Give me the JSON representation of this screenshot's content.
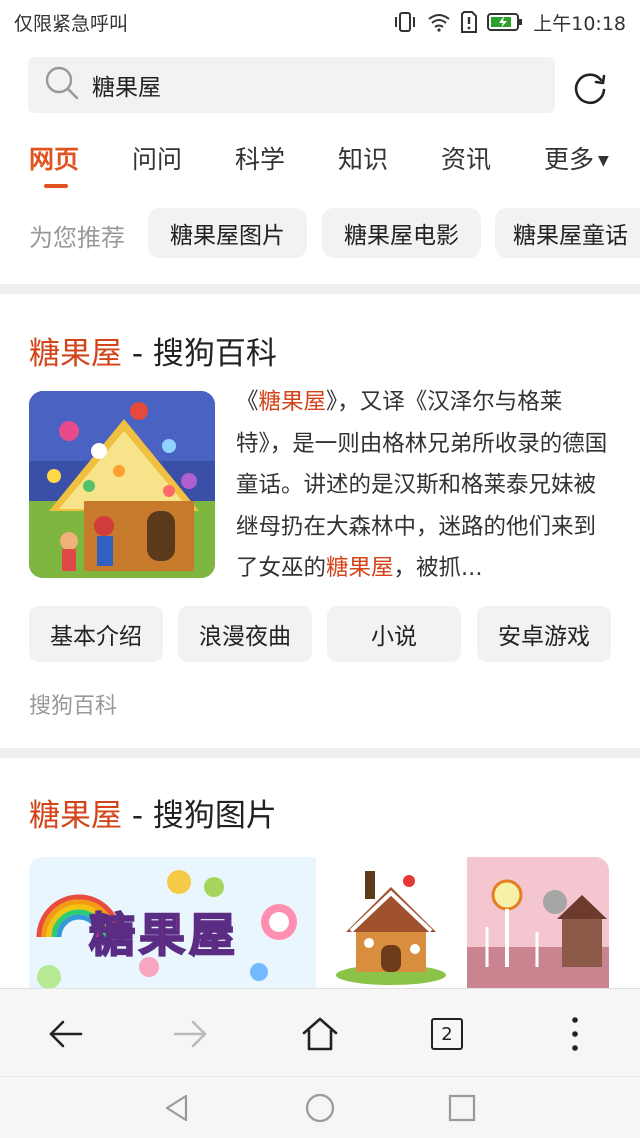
{
  "status_bar": {
    "emergency_text": "仅限紧急呼叫",
    "time": "上午10:18"
  },
  "search": {
    "query": "糖果屋"
  },
  "tabs": [
    {
      "label": "网页",
      "active": true
    },
    {
      "label": "问问",
      "active": false
    },
    {
      "label": "科学",
      "active": false
    },
    {
      "label": "知识",
      "active": false
    },
    {
      "label": "资讯",
      "active": false
    },
    {
      "label": "更多",
      "active": false
    }
  ],
  "recommend": {
    "label": "为您推荐",
    "chips": [
      "糖果屋图片",
      "糖果屋电影",
      "糖果屋童话"
    ]
  },
  "baike_card": {
    "title_keyword": "糖果屋",
    "title_rest": " - 搜狗百科",
    "text_parts": [
      {
        "text": "《",
        "hl": false
      },
      {
        "text": "糖果屋",
        "hl": true
      },
      {
        "text": "》，又译《汉泽尔与格莱特》，是一则由格林兄弟所收录的德国童话。讲述的是汉斯和格莱泰兄妹被继母扔在大森林中，迷路的他们来到了女巫的",
        "hl": false
      },
      {
        "text": "糖果屋",
        "hl": true
      },
      {
        "text": "，被抓...",
        "hl": false
      }
    ],
    "sub_links": [
      "基本介绍",
      "浪漫夜曲",
      "小说",
      "安卓游戏"
    ],
    "source": "搜狗百科"
  },
  "image_card": {
    "title_keyword": "糖果屋",
    "title_rest": " - 搜狗图片",
    "logo_text": "糖果屋"
  },
  "bottom_bar": {
    "tab_count": "2"
  },
  "colors": {
    "accent": "#e0531f",
    "highlight": "#d4441b",
    "chip_bg": "#f2f2f2"
  }
}
